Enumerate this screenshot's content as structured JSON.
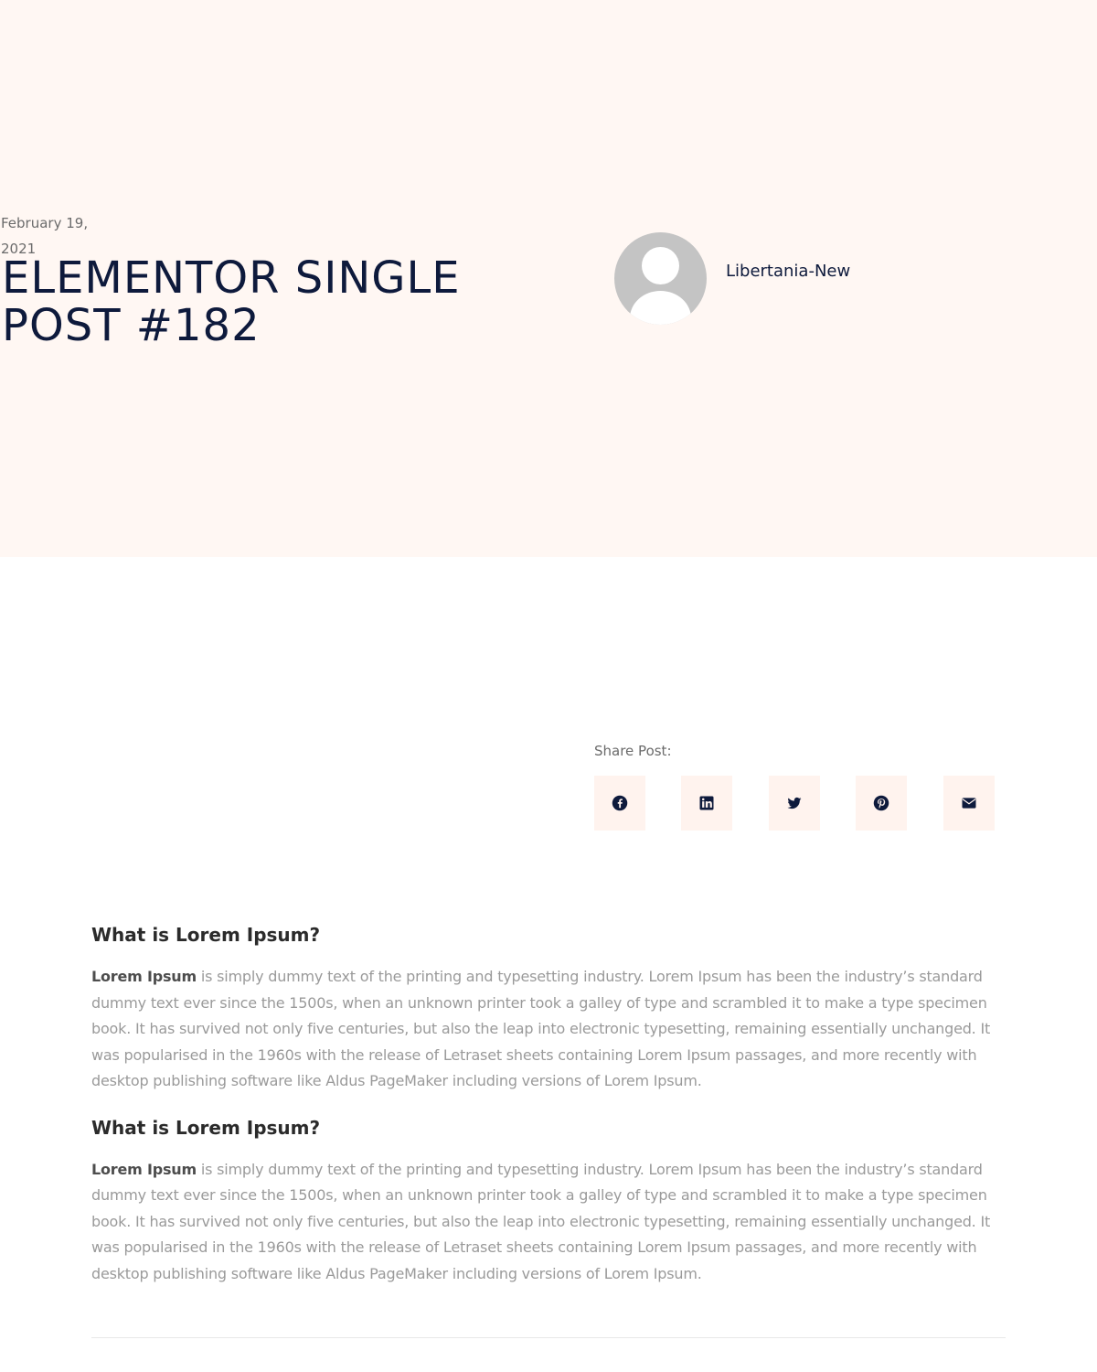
{
  "post": {
    "date": "February 19, 2021",
    "title": "ELEMENTOR SINGLE POST #182",
    "author": "Libertania-New"
  },
  "share": {
    "label": "Share Post:",
    "buttons": [
      {
        "name": "facebook",
        "icon": "facebook-icon"
      },
      {
        "name": "linkedin",
        "icon": "linkedin-icon"
      },
      {
        "name": "twitter",
        "icon": "twitter-icon"
      },
      {
        "name": "pinterest",
        "icon": "pinterest-icon"
      },
      {
        "name": "email",
        "icon": "envelope-icon"
      }
    ]
  },
  "sections": [
    {
      "heading": "What is Lorem Ipsum?",
      "lead": "Lorem Ipsum",
      "body": " is simply dummy text of the printing and typesetting industry. Lorem Ipsum has been the industry’s standard dummy text ever since the 1500s, when an unknown printer took a galley of type and scrambled it to make a type specimen book. It has survived not only five centuries, but also the leap into electronic typesetting, remaining essentially unchanged. It was popularised in the 1960s with the release of Letraset sheets containing Lorem Ipsum passages, and more recently with desktop publishing software like Aldus PageMaker including versions of Lorem Ipsum."
    },
    {
      "heading": "What is Lorem Ipsum?",
      "lead": "Lorem Ipsum",
      "body": " is simply dummy text of the printing and typesetting industry. Lorem Ipsum has been the industry’s standard dummy text ever since the 1500s, when an unknown printer took a galley of type and scrambled it to make a type specimen book. It has survived not only five centuries, but also the leap into electronic typesetting, remaining essentially unchanged. It was popularised in the 1960s with the release of Letraset sheets containing Lorem Ipsum passages, and more recently with desktop publishing software like Aldus PageMaker including versions of Lorem Ipsum."
    }
  ],
  "colors": {
    "hero_bg": "#fff7f3",
    "title": "#0e1a3c",
    "share_bg": "#fff3ee",
    "body_text": "#9a9a9a"
  }
}
